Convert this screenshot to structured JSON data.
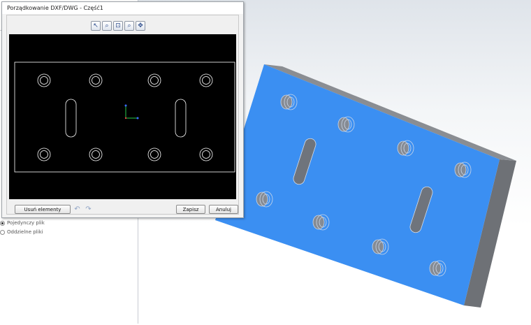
{
  "dialog": {
    "title": "Porządkowanie DXF/DWG - Część1",
    "toolbar": [
      {
        "icon": "select-icon",
        "glyph": "↖"
      },
      {
        "icon": "zoom-to-area-icon",
        "glyph": "⌕"
      },
      {
        "icon": "zoom-fit-icon",
        "glyph": "⊡"
      },
      {
        "icon": "zoom-in-out-icon",
        "glyph": "⌕"
      },
      {
        "icon": "pan-icon",
        "glyph": "✥"
      }
    ],
    "buttons": {
      "remove": "Usuń elementy",
      "save": "Zapisz",
      "cancel": "Anuluj"
    },
    "undo_glyph": "↶",
    "redo_glyph": "↷"
  },
  "left_panel": {
    "options": [
      {
        "label": "Pojedynczy plik",
        "checked": true
      },
      {
        "label": "Oddzielne pliki",
        "checked": false
      }
    ]
  },
  "colors": {
    "part_face": "#3b8ff2",
    "part_side": "#6d7075",
    "preview_bg": "#000000",
    "preview_lines": "#ffffff"
  }
}
